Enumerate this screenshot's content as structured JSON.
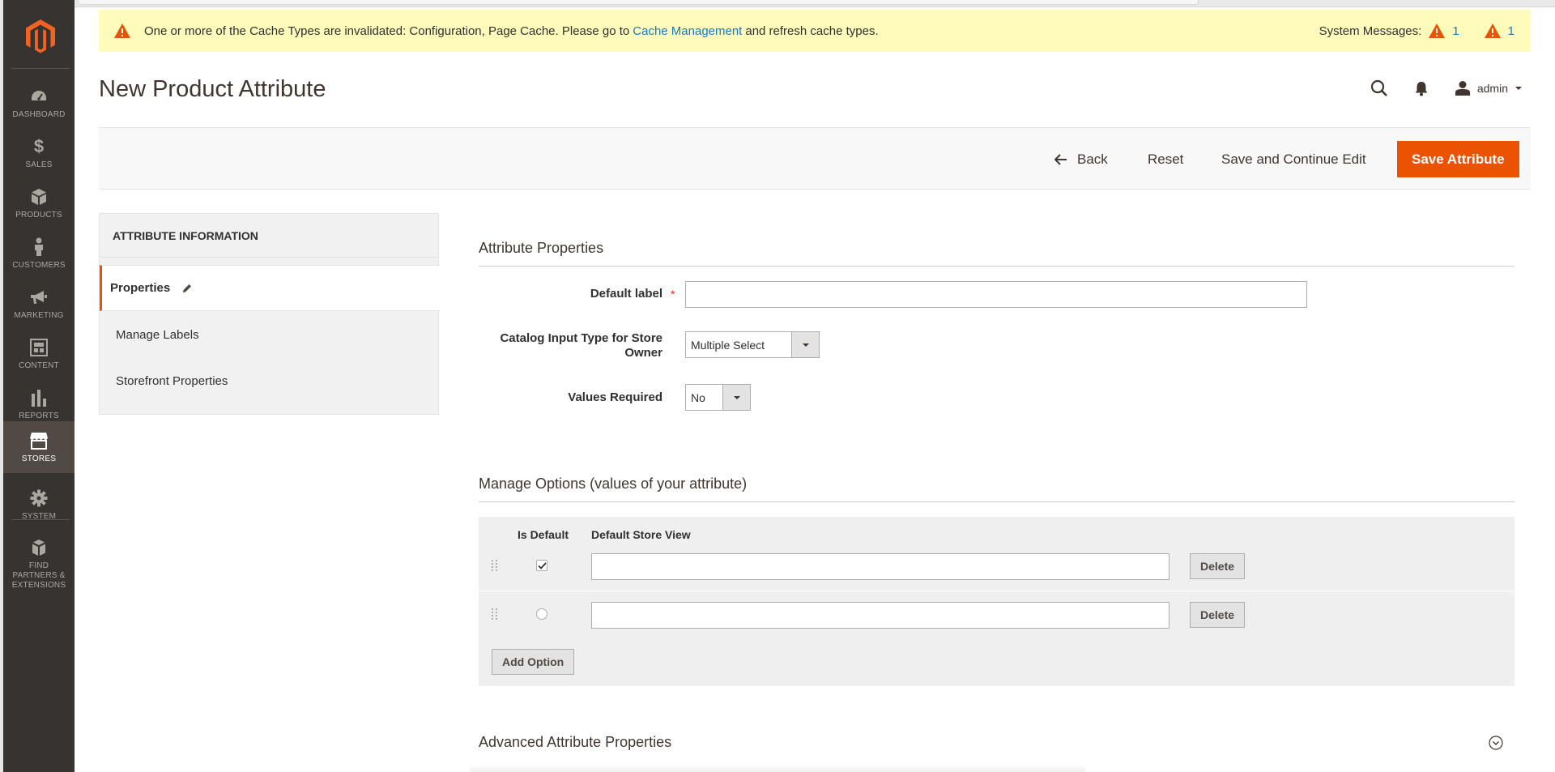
{
  "sidebar": {
    "items": [
      {
        "label": "DASHBOARD",
        "icon": "dashboard-icon"
      },
      {
        "label": "SALES",
        "icon": "dollar-icon"
      },
      {
        "label": "PRODUCTS",
        "icon": "box-icon"
      },
      {
        "label": "CUSTOMERS",
        "icon": "person-icon"
      },
      {
        "label": "MARKETING",
        "icon": "megaphone-icon"
      },
      {
        "label": "CONTENT",
        "icon": "layout-icon"
      },
      {
        "label": "REPORTS",
        "icon": "bar-chart-icon"
      },
      {
        "label": "STORES",
        "icon": "store-icon"
      },
      {
        "label": "SYSTEM",
        "icon": "gear-icon"
      },
      {
        "label": "FIND PARTNERS & EXTENSIONS",
        "icon": "cubes-icon"
      }
    ],
    "active": "STORES"
  },
  "system_message": {
    "text_before": "One or more of the Cache Types are invalidated: Configuration, Page Cache. Please go to",
    "link": "Cache Management",
    "text_after": "and refresh cache types.",
    "label": "System Messages:",
    "count_critical": "1",
    "count_major": "1"
  },
  "header": {
    "title": "New Product Attribute",
    "user": "admin"
  },
  "toolbar": {
    "back": "Back",
    "reset": "Reset",
    "save_continue": "Save and Continue Edit",
    "save": "Save Attribute"
  },
  "tabs": {
    "title": "ATTRIBUTE INFORMATION",
    "items": [
      "Properties",
      "Manage Labels",
      "Storefront Properties"
    ]
  },
  "attribute_properties": {
    "title": "Attribute Properties",
    "default_label": {
      "label": "Default label",
      "value": ""
    },
    "input_type": {
      "label_line1": "Catalog Input Type for Store",
      "label_line2": "Owner",
      "value": "Multiple Select"
    },
    "values_required": {
      "label": "Values Required",
      "value": "No"
    }
  },
  "manage_options": {
    "title": "Manage Options (values of your attribute)",
    "col_is_default": "Is Default",
    "col_store_view": "Default Store View",
    "rows": [
      {
        "is_default": true,
        "value": "",
        "delete": "Delete"
      },
      {
        "is_default": false,
        "value": "",
        "delete": "Delete"
      }
    ],
    "add_option": "Add Option"
  },
  "advanced": {
    "title": "Advanced Attribute Properties"
  },
  "colors": {
    "accent": "#eb5202",
    "sidebar_bg": "#373330",
    "link": "#1979c3",
    "notice_bg": "#fffbbb"
  }
}
